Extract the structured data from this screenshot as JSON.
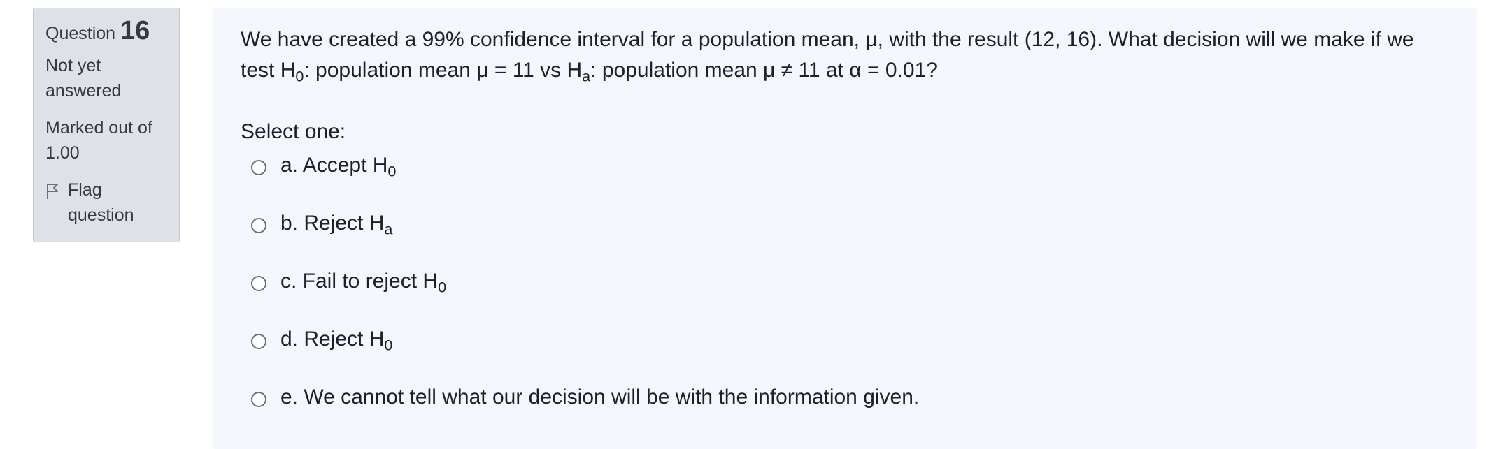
{
  "info": {
    "question_label": "Question",
    "question_number": "16",
    "state": "Not yet answered",
    "grade": "Marked out of 1.00",
    "flag_label": "Flag question"
  },
  "question": {
    "text_part1": "We have created a 99% confidence interval for a population mean, μ, with the result (12, 16). What decision will we make if we test H",
    "text_sub1": "0",
    "text_part2": ": population mean μ = 11 vs H",
    "text_sub2": "a",
    "text_part3": ": population mean μ ≠ 11 at α = 0.01?",
    "prompt": "Select one:",
    "options": [
      {
        "text": "a. Accept H",
        "sub": "0"
      },
      {
        "text": "b. Reject H",
        "sub": "a"
      },
      {
        "text": "c. Fail to reject H",
        "sub": "0"
      },
      {
        "text": "d. Reject H",
        "sub": "0"
      },
      {
        "text": "e. We cannot tell what our decision will be with the information given.",
        "sub": ""
      }
    ]
  },
  "icons": {
    "flag": "flag-icon",
    "radio": "radio-icon"
  },
  "colors": {
    "info_bg": "#dee2e6",
    "content_bg": "#f4f7fc",
    "text": "#1d2125"
  }
}
